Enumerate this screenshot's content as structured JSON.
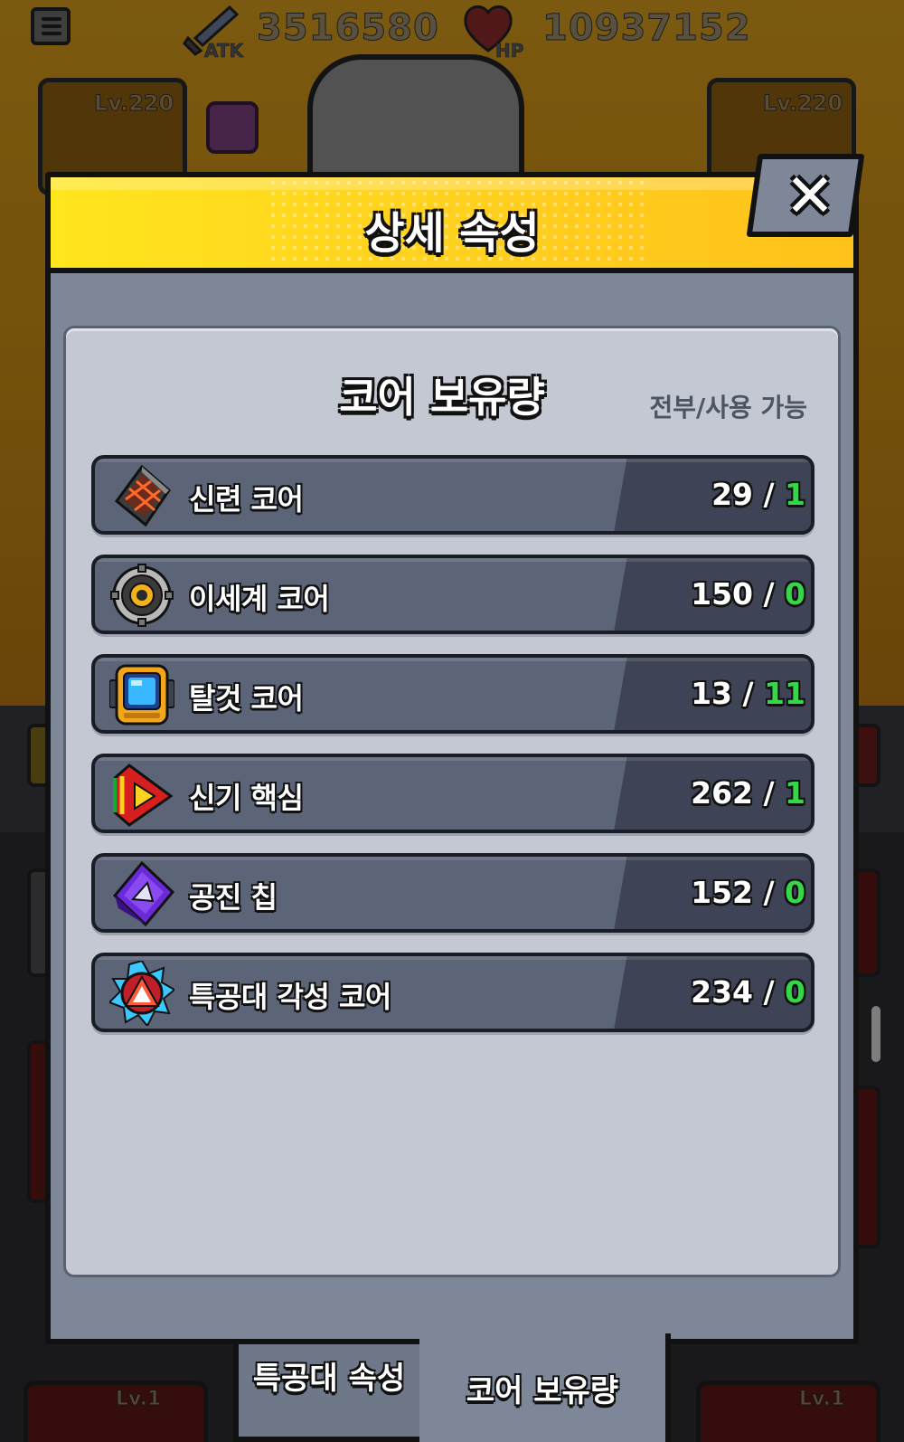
{
  "background": {
    "atk_label": "ATK",
    "atk_value": "3516580",
    "hp_label": "HP",
    "hp_value": "10937152",
    "left_card_level": "Lv.220",
    "right_card_level": "Lv.220",
    "bottom_left_level": "Lv.1",
    "bottom_right_level": "Lv.1"
  },
  "modal": {
    "title": "상세 속성",
    "close_icon": "close-icon"
  },
  "panel": {
    "title": "코어 보유량",
    "subtitle": "전부/사용 가능"
  },
  "cores": [
    {
      "name": "신련 코어",
      "total": "29",
      "available": "1",
      "icon": "training-core-icon"
    },
    {
      "name": "이세계 코어",
      "total": "150",
      "available": "0",
      "icon": "otherworld-core-icon"
    },
    {
      "name": "탈것 코어",
      "total": "13",
      "available": "11",
      "icon": "mount-core-icon"
    },
    {
      "name": "신기 핵심",
      "total": "262",
      "available": "1",
      "icon": "artifact-core-icon"
    },
    {
      "name": "공진 칩",
      "total": "152",
      "available": "0",
      "icon": "resonance-chip-icon"
    },
    {
      "name": "특공대 각성 코어",
      "total": "234",
      "available": "0",
      "icon": "squad-awakening-core-icon"
    }
  ],
  "count_separator": " / ",
  "tabs": [
    {
      "label": "특공대 속성",
      "active": false
    },
    {
      "label": "코어 보유량",
      "active": true
    }
  ],
  "colors": {
    "header_yellow": "#ffd21f",
    "available_green": "#35d64a",
    "modal_gray": "#7d8798",
    "panel_light": "#c4c8d2"
  }
}
